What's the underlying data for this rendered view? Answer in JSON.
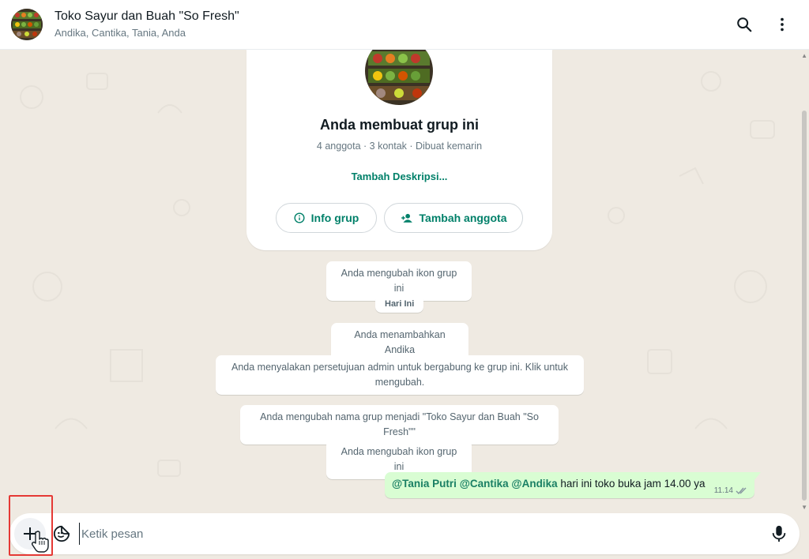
{
  "header": {
    "title": "Toko Sayur dan Buah \"So Fresh\"",
    "subtitle": "Andika, Cantika, Tania, Anda",
    "search_icon": "search-icon",
    "menu_icon": "more-vert-icon"
  },
  "card": {
    "title": "Anda membuat grup ini",
    "meta": "4 anggota · 3 kontak · Dibuat kemarin",
    "add_description": "Tambah Deskripsi...",
    "info_button": "Info grup",
    "add_member_button": "Tambah anggota"
  },
  "system_messages": [
    "Anda mengubah ikon grup ini",
    "Hari Ini",
    "Anda menambahkan Andika",
    "Anda menyalakan persetujuan admin untuk bergabung ke grup ini. Klik untuk mengubah.",
    "Anda mengubah nama grup menjadi \"Toko Sayur dan Buah \"So Fresh\"\"",
    "Anda mengubah ikon grup ini"
  ],
  "outgoing": {
    "mention1": "@Tania Putri",
    "mention2": "@Cantika",
    "mention3": "@Andika",
    "text": "hari ini toko buka jam 14.00 ya",
    "time": "11.14"
  },
  "composer": {
    "placeholder": "Ketik pesan"
  },
  "colors": {
    "accent": "#008069",
    "outgoing_bubble": "#d9fdd3",
    "background": "#efeae2",
    "highlight": "#e53935"
  }
}
